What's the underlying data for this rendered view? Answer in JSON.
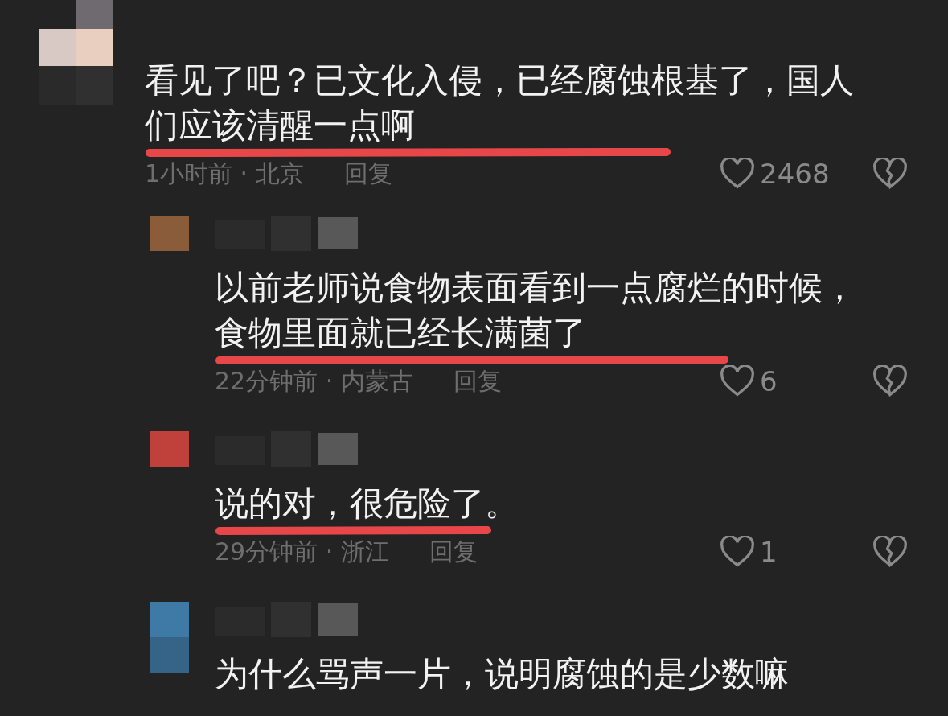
{
  "comments": [
    {
      "text": "看见了吧？已文化入侵，已经腐蚀根基了，国人们应该清醒一点啊",
      "time": "1小时前 · 北京",
      "reply": "回复",
      "likes": "2468",
      "children": [
        {
          "text": "以前老师说食物表面看到一点腐烂的时候，食物里面就已经长满菌了",
          "time": "22分钟前 · 内蒙古",
          "reply": "回复",
          "likes": "6"
        },
        {
          "text": "说的对，很危险了。",
          "time": "29分钟前 · 浙江",
          "reply": "回复",
          "likes": "1"
        },
        {
          "text": "为什么骂声一片，说明腐蚀的是少数嘛"
        }
      ]
    }
  ]
}
